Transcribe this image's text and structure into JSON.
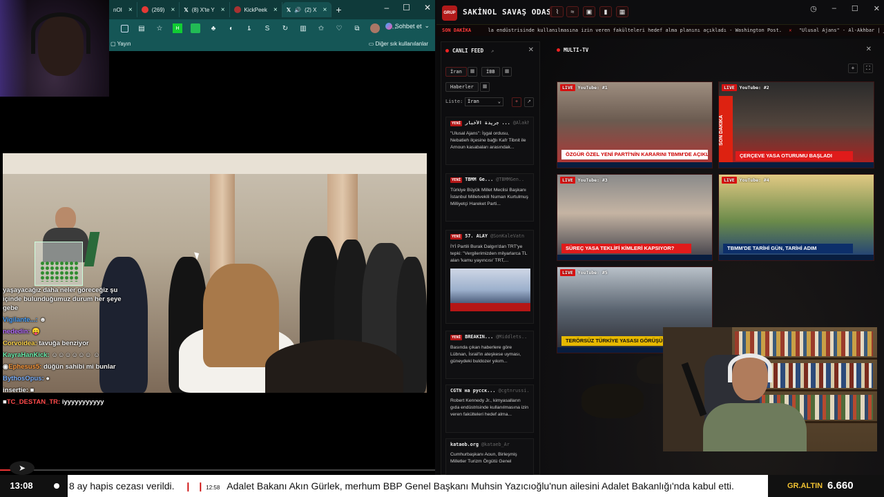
{
  "browser": {
    "tabs": [
      {
        "label": "nOI",
        "color": "#2e7d7d"
      },
      {
        "label": "(269)",
        "color": "#e53935"
      },
      {
        "label": "(8) X'te Y",
        "color": "#000000"
      },
      {
        "label": "KickPeek",
        "color": "#a83232"
      },
      {
        "label": "(2) X",
        "color": "#000000"
      }
    ],
    "sohbet_label": "Sohbet et",
    "bookmark_left": "Yayın",
    "bookmark_right": "Diğer sık kullanılanlar"
  },
  "chat": [
    {
      "user": "",
      "text": "yaşayacağız daha neler göreceğiz şu içinde bulunduğumuz durum her şeye gebe",
      "color": "#ffffff"
    },
    {
      "user": "Vigilante...:",
      "text": "",
      "color": "#4aa3ff"
    },
    {
      "user": "nededin:",
      "text": "",
      "color": "#b36bff"
    },
    {
      "user": "Corvoidea:",
      "text": "tavuğa benziyor",
      "color": "#ffd54a"
    },
    {
      "user": "KayraHanKick:",
      "text": "",
      "color": "#69f0ae"
    },
    {
      "user": "Ephesus5:",
      "text": "düğün sahibi mi bunlar",
      "color": "#ff9a3c"
    },
    {
      "user": "BythosOpus:",
      "text": "",
      "color": "#7fb3ff"
    },
    {
      "user": "insertie:",
      "text": "",
      "color": "#ffffff"
    },
    {
      "user": "TC_DESTAN_TR:",
      "text": "iyyyyyyyyyyy",
      "color": "#ff4a4a"
    }
  ],
  "progress": 0.05,
  "dashboard": {
    "title": "SAKİNOL SAVAŞ ODASI",
    "ticker_label": "SON DAKİKA",
    "ticker_text": "la endüstrisinde kullanılmasına izin veren fakülteleri hedef alma planını açıkladı - Washington Post.",
    "ticker_text_2": "\"Ulusal Ajans\" - Al-Akhbar | جريدة الأخبار"
  },
  "feed": {
    "title": "CANLI FEED",
    "chips": [
      "İran",
      "İBB",
      "Haberler"
    ],
    "list_label": "Liste:",
    "list_value": "İran",
    "items": [
      {
        "tag": "YENİ",
        "source": "جريدة الأخبار ...",
        "handle": "@Alakh..",
        "text": "\"Ulusal Ajans\": İşgal ordusu, Nebatieh ilçesine bağlı Kafr Tibnit ile Arnoun kasabaları arasındak..."
      },
      {
        "tag": "YENİ",
        "source": "TBMM Ge...",
        "handle": "@TBMMGen..",
        "text": "Türkiye Büyük Millet Meclisi Başkanı İstanbul Milletvekili Numan Kurtulmuş Milliyetçi Hareket Parti..."
      },
      {
        "tag": "YENİ",
        "source": "57. ALAY",
        "handle": "@SonKaleVatn",
        "text": "İYİ Partili Burak Dalgın'dan TRT'ye tepki: \"Vergilerimizden milyarlarca TL alan 'kamu yayıncısı' TRT,..."
      },
      {
        "tag": "YENİ",
        "source": "BREAKIN...",
        "handle": "@Middlets..",
        "text": "Basında çıkan haberlere göre Lübnan, İsrail'in ateşkese uyması, güneydeki buldozer yıkım..."
      },
      {
        "tag": "",
        "source": "CGTN на русск...",
        "handle": "@cgtnrussi..",
        "text": "Robert Kennedy Jr., kimyasalların gıda endüstrisinde kullanılmasına izin veren fakülteleri hedef alma..."
      },
      {
        "tag": "",
        "source": "kataeb.org",
        "handle": "@kataeb_Ar",
        "text": "Cumhurbaşkanı Aoun, Birleşmiş Milletler Turizm Örgütü Genel"
      }
    ]
  },
  "multitv": {
    "title": "MULTI-TV",
    "screens": [
      {
        "label": "YouTube: #1",
        "caption": "ÖZGÜR ÖZEL YENİ PARTİ'NİN KARARINI TBMM'DE AÇIKLAYACAK",
        "style": "red"
      },
      {
        "label": "YouTube: #2",
        "caption": "ÇERÇEVE YASA OTURUMU BAŞLADI",
        "style": "red"
      },
      {
        "label": "YouTube: #3",
        "caption": "SÜREÇ YASA TEKLİFİ KİMLERİ KAPSIYOR?",
        "style": "red"
      },
      {
        "label": "YouTube: #4",
        "caption": "TBMM'DE TARİHİ GÜN, TARİHİ ADIM",
        "style": "red"
      },
      {
        "label": "YouTube: #5",
        "caption": "TERÖRSÜZ TÜRKİYE YASASI GÖRÜŞÜLÜ",
        "style": "gold"
      }
    ]
  },
  "bottom": {
    "clock": "13:08",
    "ticker_a": "8 ay hapis cezası verildi.",
    "ticker_time": "12:58",
    "ticker_b": "Adalet Bakanı Akın Gürlek, merhum BBP Genel Başkanı Muhsin Yazıcıoğlu'nun ailesini Adalet Bakanlığı'nda kabul etti.",
    "gold_label": "GR.ALTIN",
    "gold_value": "6.660"
  }
}
